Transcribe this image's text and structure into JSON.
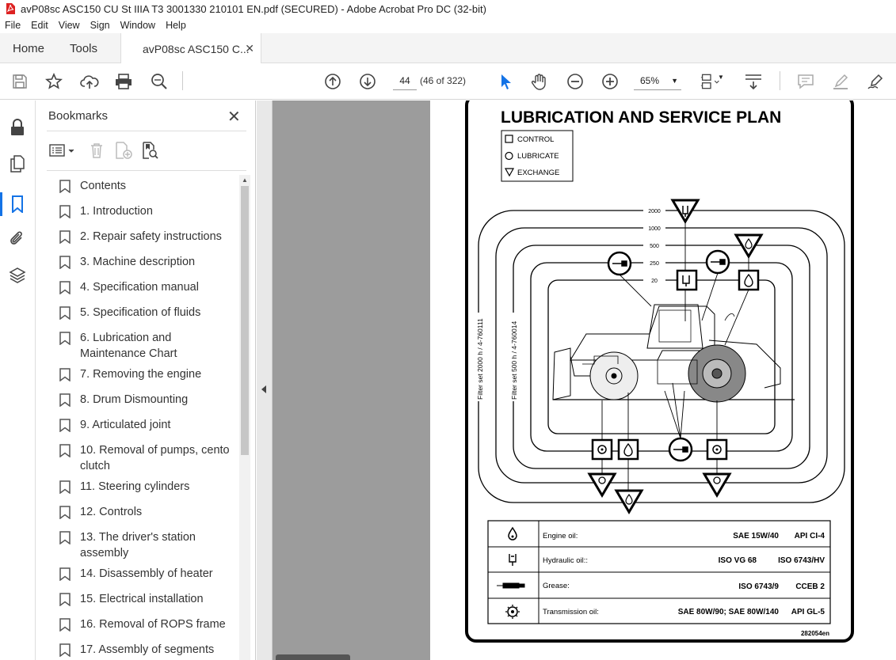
{
  "window": {
    "title": "avP08sc ASC150 CU St IIIA T3 3001330 210101 EN.pdf (SECURED) - Adobe Acrobat Pro DC (32-bit)"
  },
  "menu": [
    "File",
    "Edit",
    "View",
    "Sign",
    "Window",
    "Help"
  ],
  "tabs": {
    "home": "Home",
    "tools": "Tools",
    "document": "avP08sc ASC150 C..."
  },
  "toolbar": {
    "page_number": "44",
    "page_count": "(46 of 322)",
    "zoom": "65%"
  },
  "bookmarks": {
    "title": "Bookmarks",
    "items": [
      {
        "label": "Contents"
      },
      {
        "label": "1. Introduction"
      },
      {
        "label": "2. Repair safety instructions"
      },
      {
        "label": "3. Machine description"
      },
      {
        "label": "4. Specification manual"
      },
      {
        "label": "5. Specification of fluids"
      },
      {
        "label": "6. Lubrication and Maintenance Chart"
      },
      {
        "label": "7. Removing the engine"
      },
      {
        "label": "8. Drum Dismounting"
      },
      {
        "label": "9. Articulated joint"
      },
      {
        "label": "10. Removal of pumps, cento clutch"
      },
      {
        "label": "11. Steering cylinders"
      },
      {
        "label": "12. Controls"
      },
      {
        "label": "13. The driver's station assembly"
      },
      {
        "label": "14. Disassembly of heater"
      },
      {
        "label": "15. Electrical installation"
      },
      {
        "label": "16. Removal of ROPS frame"
      },
      {
        "label": "17. Assembly of segments"
      }
    ]
  },
  "document": {
    "heading": "LUBRICATION AND SERVICE PLAN",
    "legend": {
      "control": "CONTROL",
      "lubricate": "LUBRICATE",
      "exchange": "EXCHANGE"
    },
    "intervals": [
      "2000",
      "1000",
      "500",
      "250",
      "20"
    ],
    "filter_labels": {
      "outer": "Filter set 2000 h / 4-760111",
      "inner": "Filter set 500 h / 4-760014"
    },
    "fluids": [
      {
        "name": "Engine oil:",
        "spec1": "SAE 15W/40",
        "spec2": "API CI-4",
        "icon": "engine-oil-icon"
      },
      {
        "name": "Hydraulic oil::",
        "spec1": "ISO VG 68",
        "spec2": "ISO 6743/HV",
        "icon": "hydraulic-oil-icon"
      },
      {
        "name": "Grease:",
        "spec1": "ISO 6743/9",
        "spec2": "CCEB 2",
        "icon": "grease-gun-icon"
      },
      {
        "name": "Transmission oil:",
        "spec1": "SAE 80W/90; SAE 80W/140",
        "spec2": "API GL-5",
        "icon": "gear-oil-icon"
      }
    ],
    "doc_number": "282054en"
  }
}
